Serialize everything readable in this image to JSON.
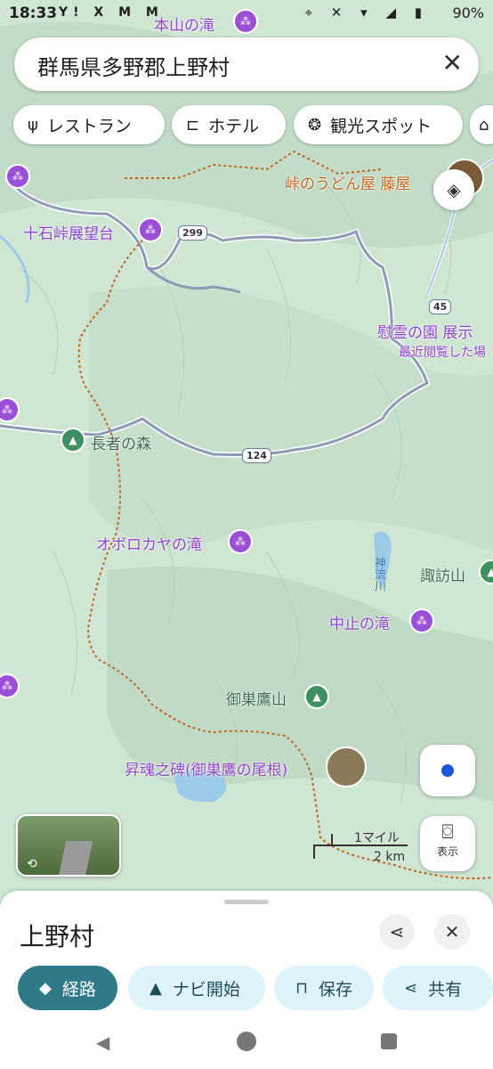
{
  "status_bar": {
    "time": "18:33",
    "notification_icons": "Y! X M M",
    "battery": "90%"
  },
  "search": {
    "query": "群馬県多野郡上野村",
    "clear_icon": "close-icon"
  },
  "chips": [
    {
      "icon": "restaurant-icon",
      "label": "レストラン"
    },
    {
      "icon": "hotel-icon",
      "label": "ホテル"
    },
    {
      "icon": "attraction-icon",
      "label": "観光スポット"
    }
  ],
  "map": {
    "labels": {
      "honzan": "本山の滝",
      "toge_udon": "峠のうどん屋 藤屋",
      "jikkoku": "十石峠展望台",
      "ireino": "慰霊の園 展示",
      "recent": "最近閲覧した場",
      "chojya": "長者の森",
      "oborokaya": "オボロカヤの滝",
      "kannagawa": "神流川",
      "suwayama": "諏訪山",
      "nakadome": "中止の滝",
      "osutaka": "御巣鷹山",
      "shokon": "昇魂之碑(御巣鷹の尾根)"
    },
    "route_shields": {
      "r299": "299",
      "r45": "45",
      "r124": "124"
    },
    "scale": {
      "imperial": "1マイル",
      "metric": "2 km"
    },
    "lens_label": "表示"
  },
  "colors": {
    "accent": "#2f7a88",
    "poi": "#9a4fd6",
    "park": "#3f9060",
    "boundary": "#c0661e"
  },
  "sheet": {
    "title": "上野村",
    "share_icon": "share-icon",
    "close_icon": "close-icon",
    "actions": [
      {
        "icon": "directions-icon",
        "label": "経路"
      },
      {
        "icon": "navigation-icon",
        "label": "ナビ開始"
      },
      {
        "icon": "bookmark-icon",
        "label": "保存"
      },
      {
        "icon": "share-icon",
        "label": "共有"
      }
    ]
  }
}
